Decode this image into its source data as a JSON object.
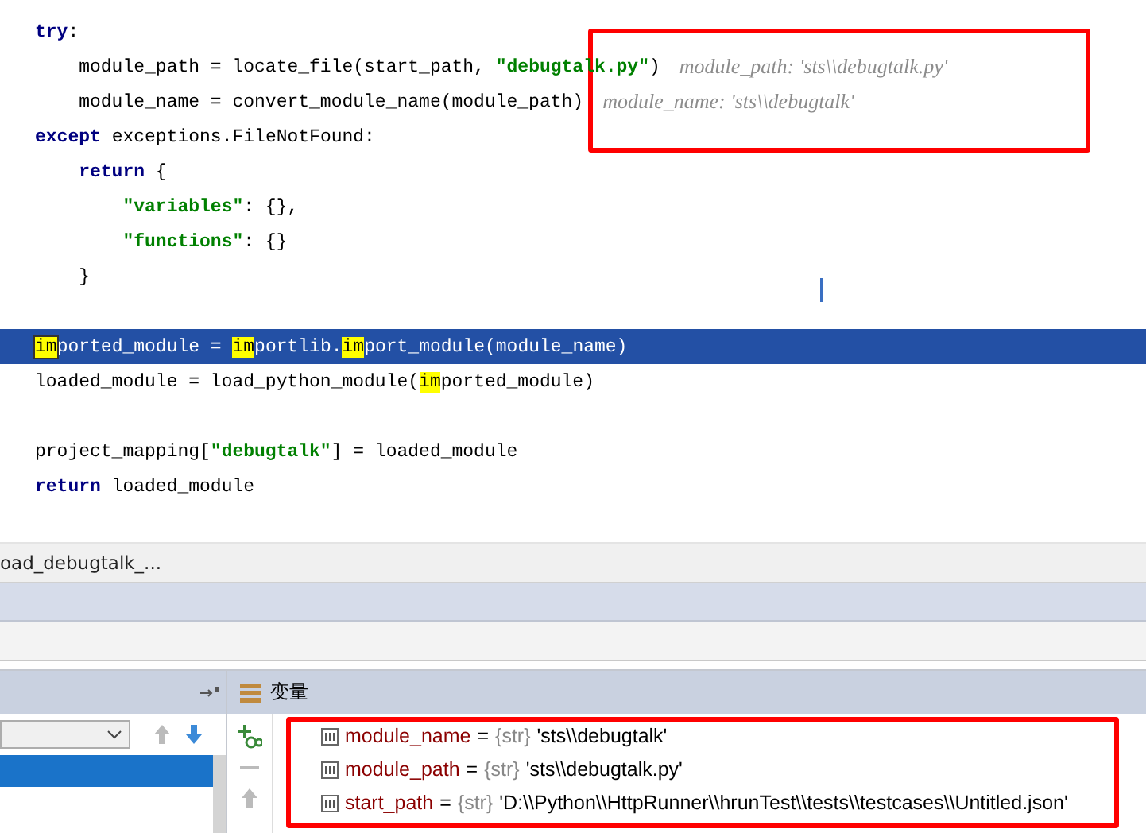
{
  "code": {
    "lines": [
      {
        "selected": false,
        "tokens": [
          {
            "kind": "kw",
            "text": "try"
          },
          {
            "kind": "plain",
            "text": ":"
          }
        ]
      },
      {
        "selected": false,
        "tokens": [
          {
            "kind": "plain",
            "text": "    module_path = locate_file(start_path, "
          },
          {
            "kind": "str",
            "text": "\"debugtalk.py\""
          },
          {
            "kind": "plain",
            "text": ")"
          },
          {
            "kind": "hint",
            "text": "module_path: 'sts\\\\debugtalk.py'"
          }
        ]
      },
      {
        "selected": false,
        "tokens": [
          {
            "kind": "plain",
            "text": "    module_name = convert_module_name(module_path)"
          },
          {
            "kind": "hint",
            "text": "module_name: 'sts\\\\debugtalk'"
          }
        ]
      },
      {
        "selected": false,
        "tokens": [
          {
            "kind": "kw",
            "text": "except"
          },
          {
            "kind": "plain",
            "text": " exceptions.FileNotFound:"
          }
        ]
      },
      {
        "selected": false,
        "tokens": [
          {
            "kind": "kw",
            "text": "    return"
          },
          {
            "kind": "plain",
            "text": " {"
          }
        ]
      },
      {
        "selected": false,
        "tokens": [
          {
            "kind": "str",
            "text": "        \"variables\""
          },
          {
            "kind": "plain",
            "text": ": {},"
          }
        ]
      },
      {
        "selected": false,
        "tokens": [
          {
            "kind": "str",
            "text": "        \"functions\""
          },
          {
            "kind": "plain",
            "text": ": {}"
          }
        ]
      },
      {
        "selected": false,
        "tokens": [
          {
            "kind": "plain",
            "text": "    }"
          }
        ]
      },
      {
        "selected": false
      },
      {
        "selected": true,
        "tokens": [
          {
            "kind": "match-current",
            "text": "im"
          },
          {
            "kind": "plain",
            "text": "ported_module = "
          },
          {
            "kind": "match",
            "text": "im"
          },
          {
            "kind": "plain",
            "text": "portlib."
          },
          {
            "kind": "match",
            "text": "im"
          },
          {
            "kind": "plain",
            "text": "port_module(module_name)"
          }
        ]
      },
      {
        "selected": false,
        "tokens": [
          {
            "kind": "plain",
            "text": "loaded_module = load_python_module("
          },
          {
            "kind": "match",
            "text": "im"
          },
          {
            "kind": "plain",
            "text": "ported_module)"
          }
        ]
      },
      {
        "selected": false
      },
      {
        "selected": false,
        "tokens": [
          {
            "kind": "plain",
            "text": "project_mapping["
          },
          {
            "kind": "str",
            "text": "\"debugtalk\""
          },
          {
            "kind": "plain",
            "text": "] = loaded_module"
          }
        ]
      },
      {
        "selected": false,
        "tokens": [
          {
            "kind": "kw",
            "text": "return"
          },
          {
            "kind": "plain",
            "text": " loaded_module"
          }
        ]
      }
    ]
  },
  "breadcrumb": "oad_debugtalk_...",
  "variables_panel": {
    "title": "变量",
    "variables": [
      {
        "name": "module_name",
        "equals": "=",
        "type": "{str}",
        "value": "'sts\\\\debugtalk'"
      },
      {
        "name": "module_path",
        "equals": "=",
        "type": "{str}",
        "value": "'sts\\\\debugtalk.py'"
      },
      {
        "name": "start_path",
        "equals": "=",
        "type": "{str}",
        "value": "'D:\\\\Python\\\\HttpRunner\\\\hrunTest\\\\tests\\\\testcases\\\\Untitled.json'"
      }
    ]
  }
}
